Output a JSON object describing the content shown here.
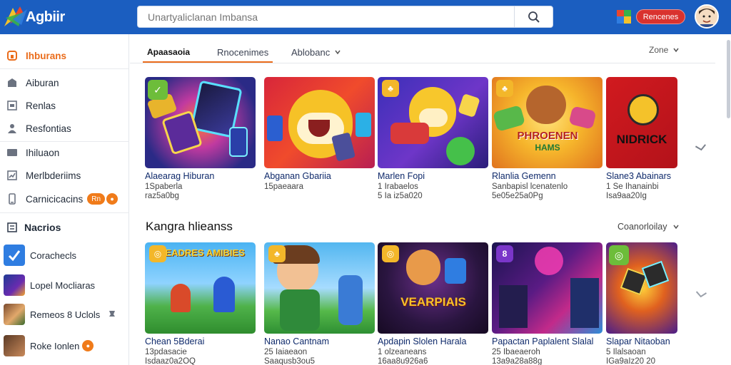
{
  "header": {
    "logo_text": "Agbiir",
    "search_placeholder": "Unartyaliclanan Imbansa",
    "search_icon": "search-icon",
    "action_button": "Rencenes",
    "brand_color": "#1b5ec0"
  },
  "sidebar": {
    "items": [
      {
        "label": "Ihburans",
        "icon": "home-icon",
        "active": true
      },
      {
        "label": "Aiburan",
        "icon": "store-icon"
      },
      {
        "label": "Renlas",
        "icon": "window-icon"
      },
      {
        "label": "Resfontias",
        "icon": "person-icon"
      },
      {
        "label": "Ihiluaon",
        "icon": "display-icon"
      },
      {
        "label": "Merlbderiims",
        "icon": "chart-icon"
      },
      {
        "label": "Carnicicacins",
        "icon": "phone-icon",
        "badge": "Rn"
      }
    ],
    "section_label": "Nacrios",
    "games": [
      {
        "label": "Corachecls"
      },
      {
        "label": "Lopel Mocliaras"
      },
      {
        "label": "Remeos 8 Uclols"
      },
      {
        "label": "Roke Ionlen"
      }
    ]
  },
  "main": {
    "tabs": [
      {
        "label": "Apaasaoia"
      },
      {
        "label": "Rnocenimes"
      },
      {
        "label": "Ablobanc"
      }
    ],
    "sort_label": "Zone",
    "row1": [
      {
        "title": "Alaearag Hiburan",
        "line1": "1Spaberla",
        "line2": "raz5a0bg"
      },
      {
        "title": "Abganan Gbariia",
        "line1": "15paeaara",
        "line2": ""
      },
      {
        "title": "Marlen Fopi",
        "line1": "1 Irabaelos",
        "line2": "5 Ia iz5a020"
      },
      {
        "title": "Rlanlia Gemenn",
        "line1": "Sanbapisl lcenatenlo",
        "line2": "5e05e25a0Pg"
      },
      {
        "title": "Slane3 Abainars",
        "line1": "1 Se Ihanainbi",
        "line2": "Isa9aa20Ig"
      }
    ],
    "section_title": "Kangra hlieanss",
    "section_more": "Coanorloilay",
    "row2": [
      {
        "title": "Chean 5Bderai",
        "line1": "13pdasacie",
        "line2": "Isdaaz0a2OQ"
      },
      {
        "title": "Nanao Cantnam",
        "line1": "25 Iaiaeaon",
        "line2": "Saaqusb3ou5"
      },
      {
        "title": "Apdapin Slolen Harala",
        "line1": "1 olzeaneans",
        "line2": "16aa8u926a6"
      },
      {
        "title": "Papactan Paplalent Slalal",
        "line1": "25 Ibaeaeroh",
        "line2": "13a9a28a88g"
      },
      {
        "title": "Slapar Nitaoban",
        "line1": "5 Ilalsaoan",
        "line2": "IGa9aIz20 20"
      }
    ],
    "card_art_texts": {
      "game4": "PHROENEN",
      "game4b": "HAMS",
      "game5": "NIDRICK",
      "game6": "WEADRES AMIBIES",
      "game8": "VEARPIAIS"
    }
  }
}
